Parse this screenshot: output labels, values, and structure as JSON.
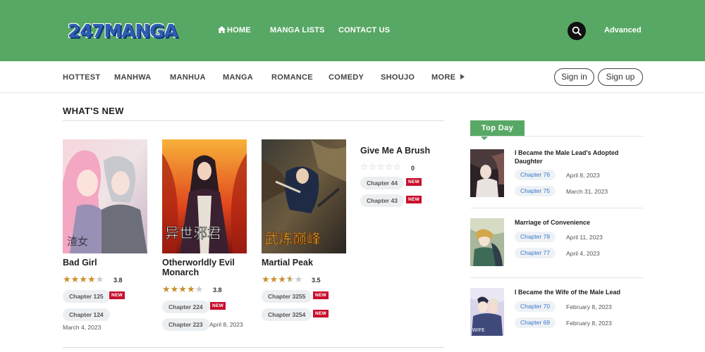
{
  "header": {
    "logo_text": "247MANGA",
    "nav": [
      {
        "label": "HOME",
        "icon": "home-icon"
      },
      {
        "label": "MANGA LISTS"
      },
      {
        "label": "CONTACT US"
      }
    ],
    "search_icon": "search-icon",
    "advanced_label": "Advanced",
    "brand_color": "#58a865"
  },
  "categories": [
    "HOTTEST",
    "MANHWA",
    "MANHUA",
    "MANGA",
    "ROMANCE",
    "COMEDY",
    "SHOUJO",
    "MORE"
  ],
  "auth": {
    "signin": "Sign in",
    "signup": "Sign up"
  },
  "whats_new": {
    "title": "WHAT'S NEW",
    "items": [
      {
        "title": "Bad Girl",
        "rating": "3.8",
        "rating_value": 3.8,
        "chapters": [
          {
            "label": "Chapter 125",
            "badge": "NEW"
          },
          {
            "label": "Chapter 124",
            "date": "March 4, 2023"
          }
        ]
      },
      {
        "title": "Otherworldly Evil Monarch",
        "rating": "3.8",
        "rating_value": 3.8,
        "chapters": [
          {
            "label": "Chapter 224",
            "badge": "NEW"
          },
          {
            "label": "Chapter 223",
            "date": "April 8, 2023"
          }
        ]
      },
      {
        "title": "Martial Peak",
        "rating": "3.5",
        "rating_value": 3.5,
        "chapters": [
          {
            "label": "Chapter 3255",
            "badge": "NEW"
          },
          {
            "label": "Chapter 3254",
            "badge": "NEW"
          }
        ]
      },
      {
        "title": "Give Me A Brush",
        "rating": "0",
        "rating_value": 0,
        "chapters": [
          {
            "label": "Chapter 44",
            "badge": "NEW"
          },
          {
            "label": "Chapter 43",
            "badge": "NEW"
          }
        ]
      }
    ]
  },
  "top_day": {
    "tab_label": "Top Day",
    "items": [
      {
        "title": "I Became the Male Lead's Adopted Daughter",
        "chapters": [
          {
            "label": "Chapter 76",
            "date": "April 8, 2023"
          },
          {
            "label": "Chapter 75",
            "date": "March 31, 2023"
          }
        ]
      },
      {
        "title": "Marriage of Convenience",
        "chapters": [
          {
            "label": "Chapter 78",
            "date": "April 11, 2023"
          },
          {
            "label": "Chapter 77",
            "date": "April 4, 2023"
          }
        ]
      },
      {
        "title": "I Became the Wife of the Male Lead",
        "chapters": [
          {
            "label": "Chapter 70",
            "date": "February 8, 2023"
          },
          {
            "label": "Chapter 69",
            "date": "February 8, 2023"
          }
        ]
      }
    ]
  }
}
